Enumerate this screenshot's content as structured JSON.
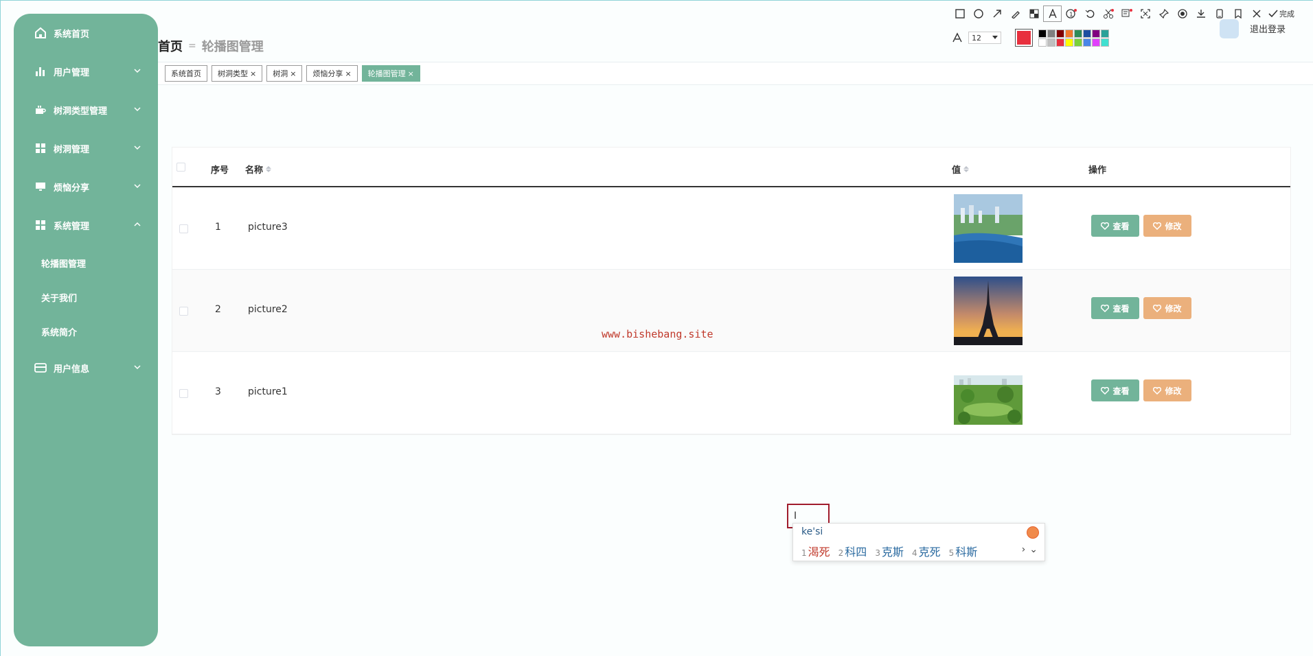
{
  "sidebar": {
    "items": [
      {
        "label": "系统首页",
        "icon": "home-icon"
      },
      {
        "label": "用户管理",
        "icon": "bar-chart-icon"
      },
      {
        "label": "树洞类型管理",
        "icon": "cup-icon"
      },
      {
        "label": "树洞管理",
        "icon": "grid-icon"
      },
      {
        "label": "烦恼分享",
        "icon": "monitor-icon"
      },
      {
        "label": "系统管理",
        "icon": "grid-icon"
      },
      {
        "label": "用户信息",
        "icon": "card-icon"
      }
    ],
    "sub_items": [
      "轮播图管理",
      "关于我们",
      "系统简介"
    ]
  },
  "header": {
    "breadcrumb_home": "首页",
    "breadcrumb_sep": "=",
    "breadcrumb_current": "轮播图管理",
    "logout": "退出登录"
  },
  "screenshot_toolbar": {
    "done_label": "完成",
    "font_size": "12",
    "current_color": "#e8303e",
    "palette": [
      "#000000",
      "#808080",
      "#800000",
      "#f0782d",
      "#2e8b57",
      "#1e4fa0",
      "#800080",
      "#2aa198",
      "#ffffff",
      "#c0c0c0",
      "#e8303e",
      "#ffff00",
      "#7cd13b",
      "#4a86e8",
      "#e040fb",
      "#40e0d0"
    ]
  },
  "tabs": [
    {
      "label": "系统首页",
      "closable": false,
      "active": false
    },
    {
      "label": "树洞类型",
      "closable": true,
      "active": false
    },
    {
      "label": "树洞",
      "closable": true,
      "active": false
    },
    {
      "label": "烦恼分享",
      "closable": true,
      "active": false
    },
    {
      "label": "轮播图管理",
      "closable": true,
      "active": true
    }
  ],
  "tab_close": "×",
  "table": {
    "columns": {
      "index": "序号",
      "name": "名称",
      "value": "值",
      "actions": "操作"
    },
    "rows": [
      {
        "index": "1",
        "name": "picture3",
        "image": "aerial-city-coast"
      },
      {
        "index": "2",
        "name": "picture2",
        "image": "eiffel-tower-sunset"
      },
      {
        "index": "3",
        "name": "picture1",
        "image": "green-park-city"
      }
    ],
    "view_label": "查看",
    "edit_label": "修改"
  },
  "watermark": "www.bishebang.site",
  "ime": {
    "input": "ke'si",
    "candidates": [
      {
        "n": "1",
        "text": "渴死"
      },
      {
        "n": "2",
        "text": "科四"
      },
      {
        "n": "3",
        "text": "克斯"
      },
      {
        "n": "4",
        "text": "克死"
      },
      {
        "n": "5",
        "text": "科斯"
      }
    ],
    "next": "›",
    "expand": "⌄"
  },
  "colors": {
    "primary": "#72b49a",
    "edit": "#ebb07c",
    "watermark": "#c0392b"
  }
}
